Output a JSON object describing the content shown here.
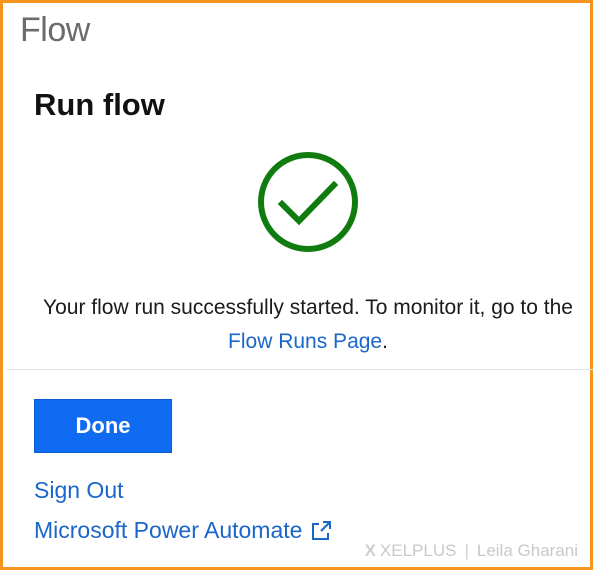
{
  "app": {
    "title": "Flow"
  },
  "panel": {
    "title": "Run flow",
    "message_prefix": "Your flow run successfully started. To monitor it, go to the",
    "message_link": "Flow Runs Page",
    "message_suffix": ".",
    "success_icon": "checkmark-circle-icon",
    "success_color": "#107c10"
  },
  "actions": {
    "done_label": "Done",
    "sign_out_label": "Sign Out",
    "power_automate_label": "Microsoft Power Automate",
    "external_icon": "external-link-icon",
    "accent_color": "#0f6cf2",
    "link_color": "#1a66c9"
  },
  "watermark": {
    "x_glyph": "X",
    "brand": "XELPLUS",
    "separator": "|",
    "author": "Leila Gharani"
  }
}
